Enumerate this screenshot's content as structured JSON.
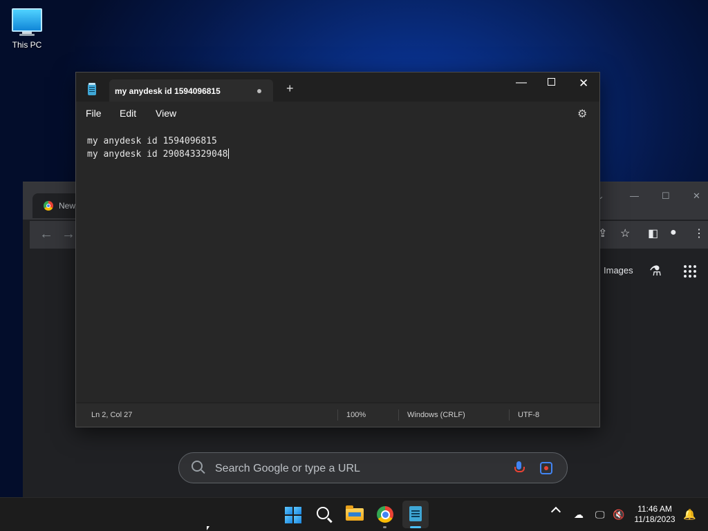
{
  "desktop": {
    "icon_label": "This PC"
  },
  "chrome": {
    "tab_title": "New",
    "images_label": "Images",
    "search_placeholder": "Search Google or type a URL"
  },
  "notepad": {
    "tab_title": "my anydesk id 1594096815",
    "menu": [
      "File",
      "Edit",
      "View"
    ],
    "lines": [
      "my anydesk id 1594096815",
      "my anydesk id 290843329048"
    ],
    "status": {
      "position": "Ln 2, Col 27",
      "zoom": "100%",
      "line_ending": "Windows (CRLF)",
      "encoding": "UTF-8"
    }
  },
  "taskbar": {
    "time": "11:46 AM",
    "date": "11/18/2023"
  }
}
